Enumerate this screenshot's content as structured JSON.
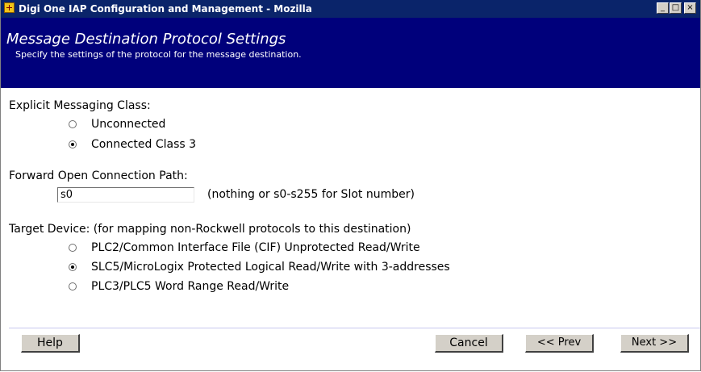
{
  "window": {
    "title": "Digi One IAP Configuration and Management - Mozilla",
    "buttons": {
      "minimize": "_",
      "maximize": "□",
      "close": "×"
    }
  },
  "header": {
    "title": "Message Destination Protocol Settings",
    "subtitle": "Specify the settings of the protocol for the message destination."
  },
  "explicit_messaging": {
    "label": "Explicit Messaging Class:",
    "options": [
      {
        "label": "Unconnected",
        "checked": false
      },
      {
        "label": "Connected Class 3",
        "checked": true
      }
    ]
  },
  "forward_open": {
    "label": "Forward Open Connection Path:",
    "value": "s0",
    "hint": "(nothing or s0-s255 for Slot number)"
  },
  "target_device": {
    "label": "Target Device: (for mapping non-Rockwell protocols to this destination)",
    "options": [
      {
        "label": "PLC2/Common Interface File (CIF) Unprotected Read/Write",
        "checked": false
      },
      {
        "label": "SLC5/MicroLogix Protected Logical Read/Write with 3-addresses",
        "checked": true
      },
      {
        "label": "PLC3/PLC5 Word Range Read/Write",
        "checked": false
      }
    ]
  },
  "footer": {
    "help": "Help",
    "cancel": "Cancel",
    "prev": "<< Prev",
    "next": "Next >>"
  }
}
